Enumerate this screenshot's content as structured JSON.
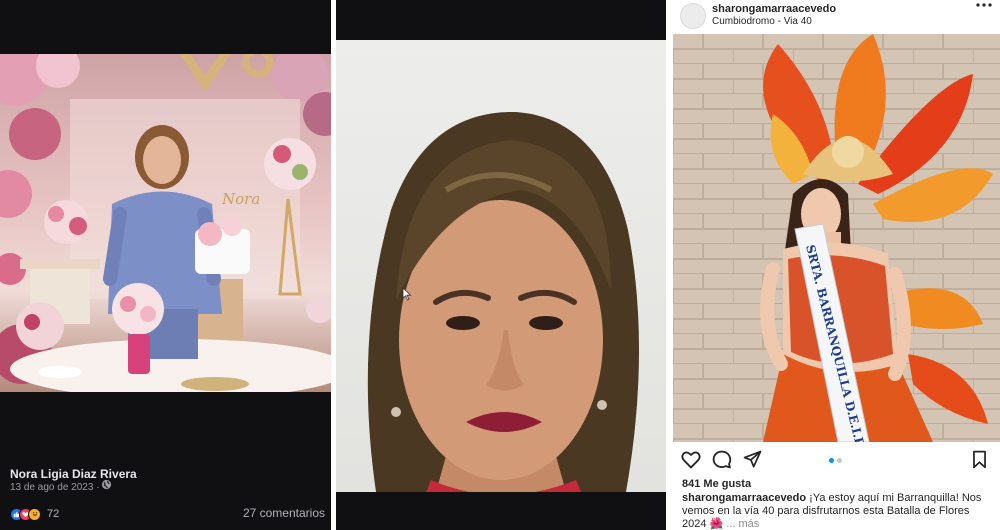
{
  "facebook_post": {
    "author": "Nora Ligia Diaz Rivera",
    "date": "13 de ago de 2023",
    "date_separator": "·",
    "privacy_icon": "globe-icon",
    "reaction_icons": [
      "like-icon",
      "love-icon",
      "haha-icon"
    ],
    "reaction_count": "72",
    "comments": "27 comentarios",
    "photo_sign_text": "Nora",
    "colors": {
      "background": "#101012",
      "text": "#e4e6eb",
      "muted": "#b0b3b8",
      "like": "#1877f2",
      "love": "#f33e58",
      "haha": "#f7b125"
    }
  },
  "portrait_photo": {
    "cursor_icon": "mouse-pointer-icon"
  },
  "instagram_post": {
    "username": "sharongamarraacevedo",
    "location": "Cumbiodromo - Via 40",
    "more_icon": "more-options-icon",
    "sash_text": "SRTA. BARRANQUILLA D.E.I.P.",
    "action_icons": [
      "heart-icon",
      "comment-icon",
      "share-icon",
      "bookmark-icon"
    ],
    "carousel_index": 1,
    "carousel_total": 2,
    "likes": "841 Me gusta",
    "caption_username": "sharongamarraacevedo",
    "caption_text": " ¡Ya estoy aquí mi Barranquilla! Nos vemos en la vía 40 para disfrutarnos esta Batalla de Flores 2024 🌺",
    "caption_more": "... más",
    "colors": {
      "text": "#262626",
      "muted": "#8e8e8e",
      "accent": "#0095f6"
    }
  }
}
